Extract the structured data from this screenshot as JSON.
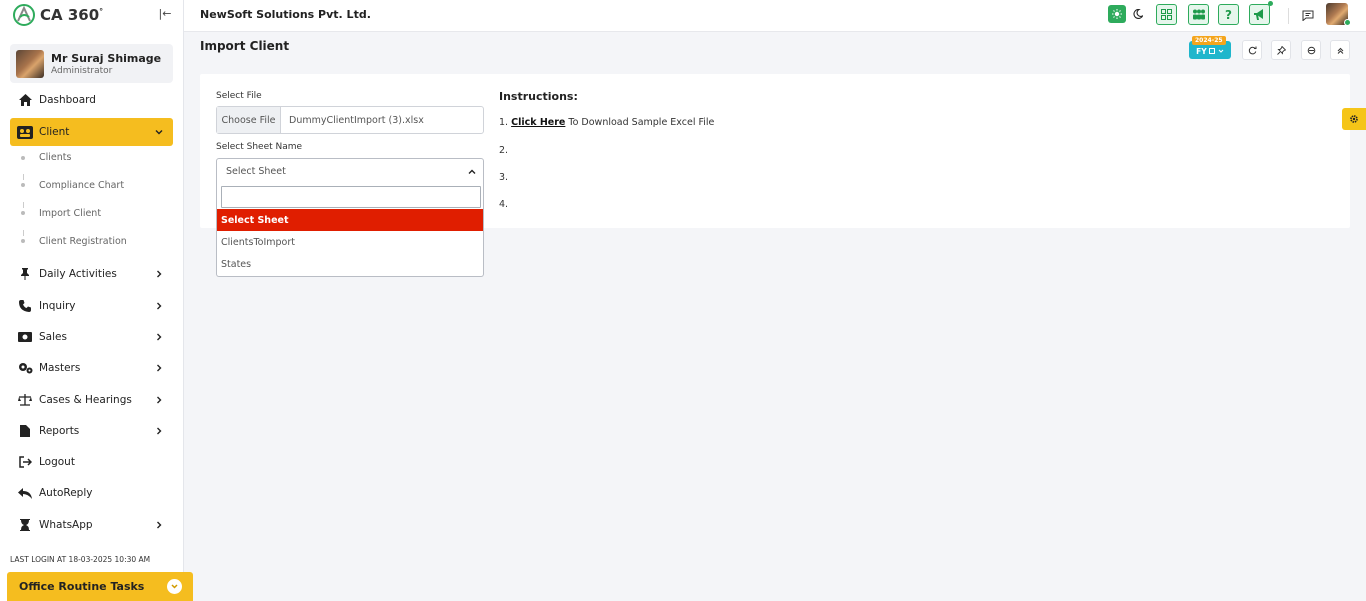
{
  "app": {
    "logo_text": "CA 360",
    "logo_degree": "°"
  },
  "user": {
    "name": "Mr Suraj Shimage",
    "role": "Administrator"
  },
  "sidebar": {
    "items": [
      {
        "label": "Dashboard"
      },
      {
        "label": "Client"
      },
      {
        "label": "Daily Activities"
      },
      {
        "label": "Inquiry"
      },
      {
        "label": "Sales"
      },
      {
        "label": "Masters"
      },
      {
        "label": "Cases & Hearings"
      },
      {
        "label": "Reports"
      },
      {
        "label": "Logout"
      },
      {
        "label": "AutoReply"
      },
      {
        "label": "WhatsApp"
      }
    ],
    "client_sub": [
      {
        "label": "Clients"
      },
      {
        "label": "Compliance Chart"
      },
      {
        "label": "Import Client"
      },
      {
        "label": "Client Registration"
      }
    ],
    "last_login": "LAST LOGIN AT 18-03-2025 10:30 AM",
    "routine_label": "Office Routine Tasks"
  },
  "header": {
    "company": "NewSoft Solutions Pvt. Ltd."
  },
  "page": {
    "title": "Import Client",
    "fy_year": "2024-25",
    "fy_label": "FY"
  },
  "form": {
    "select_file_label": "Select File",
    "choose_file": "Choose File",
    "file_name": "DummyClientImport (3).xlsx",
    "sheet_label": "Select Sheet Name",
    "sheet_selected": "Select Sheet",
    "sheet_options": [
      "Select Sheet",
      "ClientsToImport",
      "States"
    ]
  },
  "instructions": {
    "title": "Instructions:",
    "line1_prefix": "1.",
    "line1_link": "Click Here",
    "line1_rest": "To Download Sample Excel File",
    "line2": "2.",
    "line3": "3.",
    "line4": "4."
  },
  "colors": {
    "accent": "#f5bd1f",
    "success": "#2eab5c",
    "danger": "#e01e00",
    "info": "#1fb6cc"
  }
}
